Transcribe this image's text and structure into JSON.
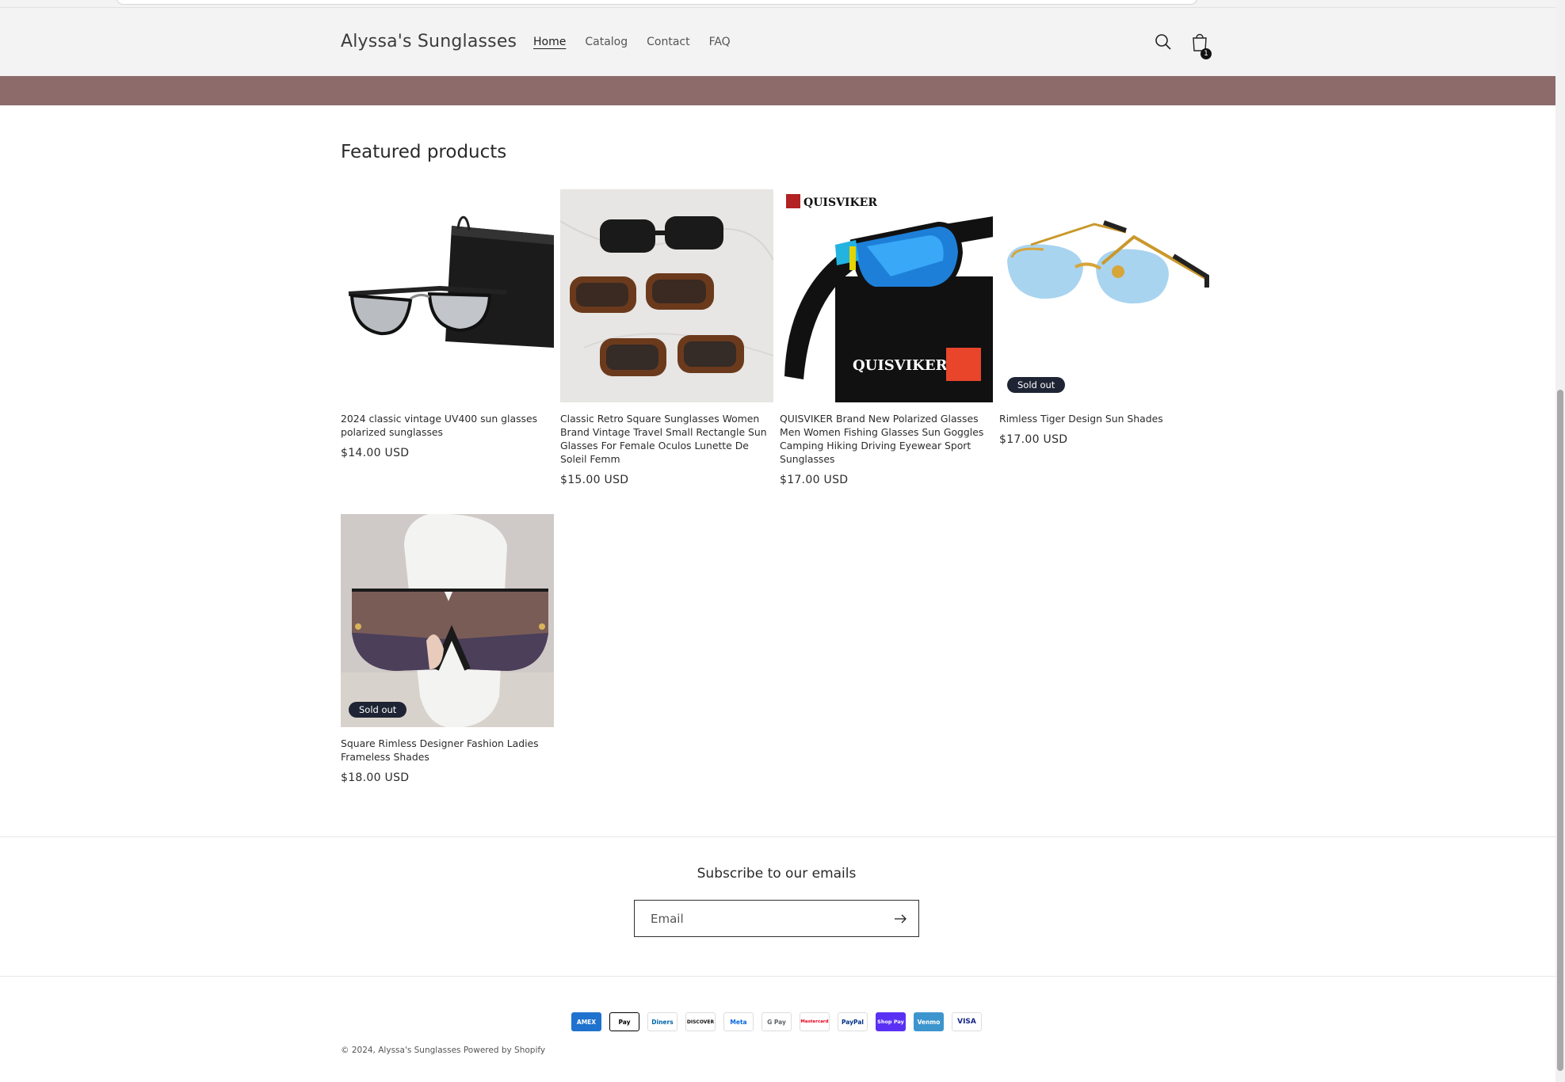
{
  "header": {
    "store_name": "Alyssa's Sunglasses",
    "nav": [
      "Home",
      "Catalog",
      "Contact",
      "FAQ"
    ],
    "active_nav": "Home",
    "cart_count": "1"
  },
  "featured": {
    "title": "Featured products",
    "products": [
      {
        "title": "2024 classic vintage UV400 sun glasses polarized sunglasses",
        "price": "$14.00 USD",
        "badge": "",
        "image": "black-clubmaster-with-black-pouch"
      },
      {
        "title": "Classic Retro Square Sunglasses Women Brand Vintage Travel Small Rectangle Sun Glasses For Female Oculos Lunette De Soleil Femm",
        "price": "$15.00 USD",
        "badge": "",
        "image": "three-rectangle-sunglasses-on-marble"
      },
      {
        "title": "QUISVIKER Brand New Polarized Glasses Men Women Fishing Glasses Sun Goggles Camping Hiking Driving Eyewear Sport Sunglasses",
        "price": "$17.00 USD",
        "badge": "",
        "image": "blue-mirror-sport-sunglasses-on-box",
        "brand_text": "QUISVIKER"
      },
      {
        "title": "Rimless Tiger Design Sun Shades",
        "price": "$17.00 USD",
        "badge": "Sold out",
        "image": "rimless-blue-gold-sunglasses"
      },
      {
        "title": "Square Rimless Designer Fashion Ladies Frameless Shades",
        "price": "$18.00 USD",
        "badge": "Sold out",
        "image": "oversized-gradient-sunglasses-on-white-case"
      }
    ]
  },
  "newsletter": {
    "title": "Subscribe to our emails",
    "placeholder": "Email"
  },
  "payments": [
    "AMEX",
    "Pay",
    "Diners",
    "DISCOVER",
    "Meta",
    "G Pay",
    "Mastercard",
    "PayPal",
    "Shop Pay",
    "Venmo",
    "VISA"
  ],
  "footer": {
    "copyright_prefix": "© 2024,",
    "store_link": "Alyssa's Sunglasses",
    "powered_by": "Powered by Shopify"
  },
  "colors": {
    "header_bg": "#f3f3f3",
    "banner": "#8e6b6b",
    "badge": "#1e2433",
    "text": "#121212"
  }
}
